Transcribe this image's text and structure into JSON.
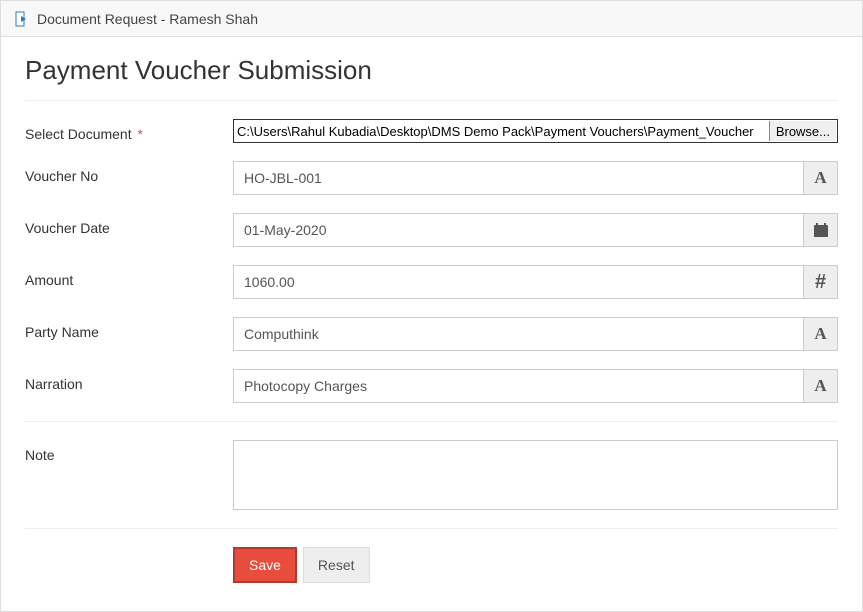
{
  "window": {
    "title": "Document Request - Ramesh Shah"
  },
  "page": {
    "title": "Payment Voucher Submission"
  },
  "form": {
    "select_document": {
      "label": "Select Document",
      "required_mark": "*",
      "value": "C:\\Users\\Rahul Kubadia\\Desktop\\DMS Demo Pack\\Payment Vouchers\\Payment_Voucher",
      "browse_label": "Browse..."
    },
    "voucher_no": {
      "label": "Voucher No",
      "value": "HO-JBL-001",
      "addon_glyph": "A"
    },
    "voucher_date": {
      "label": "Voucher Date",
      "value": "01-May-2020"
    },
    "amount": {
      "label": "Amount",
      "value": "1060.00",
      "addon_glyph": "#"
    },
    "party_name": {
      "label": "Party Name",
      "value": "Computhink",
      "addon_glyph": "A"
    },
    "narration": {
      "label": "Narration",
      "value": "Photocopy Charges",
      "addon_glyph": "A"
    },
    "note": {
      "label": "Note",
      "value": ""
    }
  },
  "buttons": {
    "save": "Save",
    "reset": "Reset"
  }
}
